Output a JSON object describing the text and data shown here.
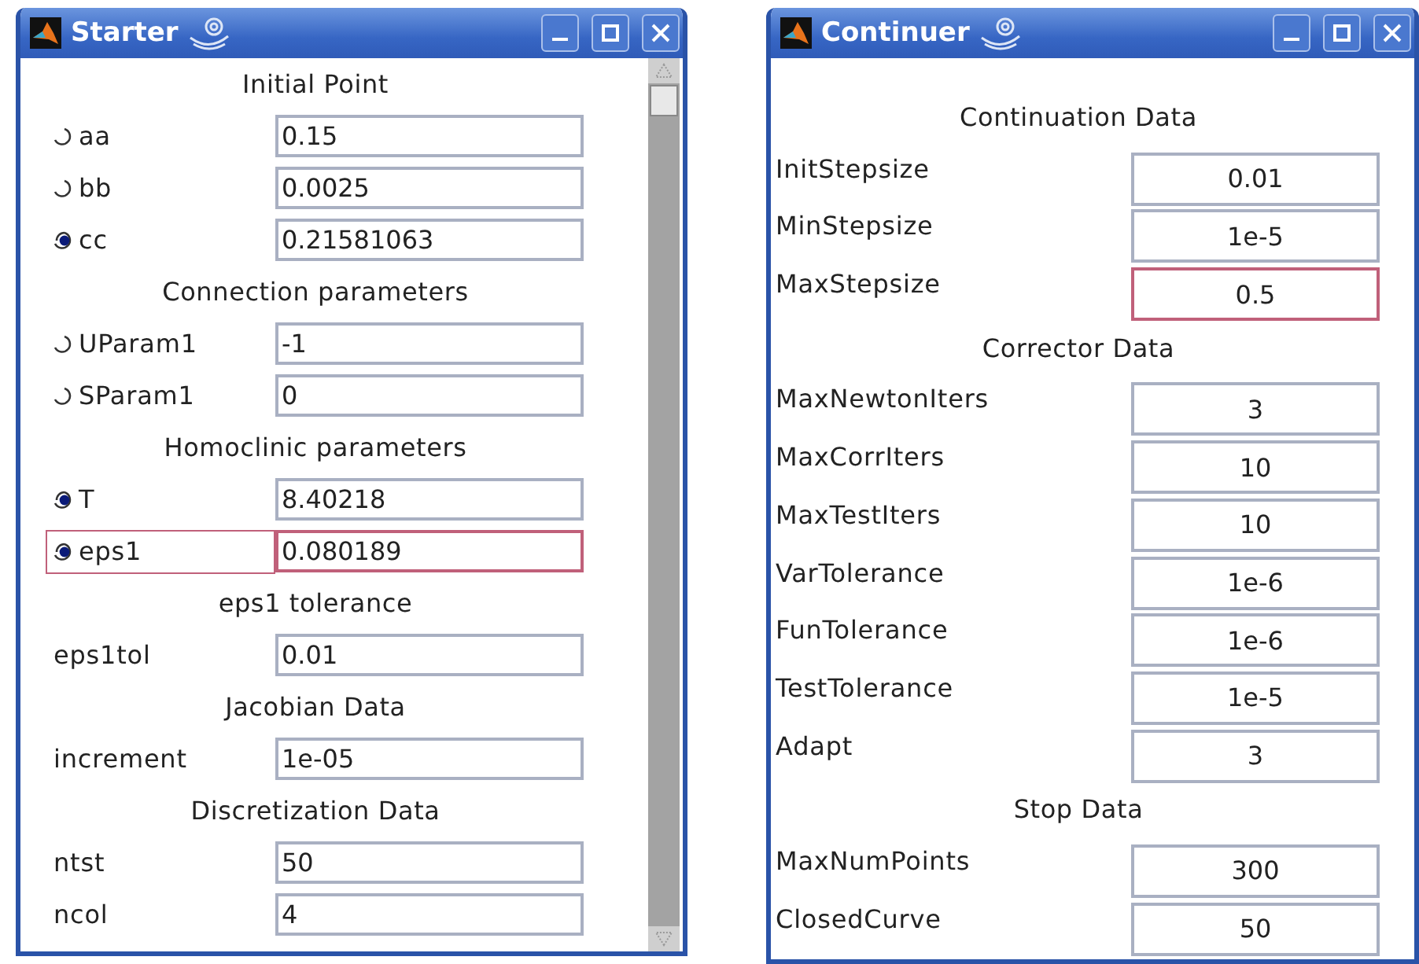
{
  "windows": [
    {
      "title": "Starter",
      "kind": "starter",
      "scrollbar": true,
      "sections": [
        {
          "heading": "Initial Point",
          "rows": [
            {
              "kind": "radio",
              "label": "aa",
              "value": "0.15",
              "selected": false,
              "focused": false
            },
            {
              "kind": "radio",
              "label": "bb",
              "value": "0.0025",
              "selected": false,
              "focused": false
            },
            {
              "kind": "radio",
              "label": "cc",
              "value": "0.21581063",
              "selected": true,
              "focused": false
            }
          ]
        },
        {
          "heading": "Connection parameters",
          "rows": [
            {
              "kind": "radio",
              "label": "UParam1",
              "value": "-1",
              "selected": false,
              "focused": false
            },
            {
              "kind": "radio",
              "label": "SParam1",
              "value": "0",
              "selected": false,
              "focused": false
            }
          ]
        },
        {
          "heading": "Homoclinic parameters",
          "rows": [
            {
              "kind": "radio",
              "label": "T",
              "value": "8.40218",
              "selected": true,
              "focused": false
            },
            {
              "kind": "radio",
              "label": "eps1",
              "value": "0.080189",
              "selected": true,
              "focused": true
            }
          ]
        },
        {
          "heading": "eps1 tolerance",
          "rows": [
            {
              "kind": "plain",
              "label": "eps1tol",
              "value": "0.01",
              "focused": false
            }
          ]
        },
        {
          "heading": "Jacobian Data",
          "rows": [
            {
              "kind": "plain",
              "label": "increment",
              "value": "1e-05",
              "focused": false
            }
          ]
        },
        {
          "heading": "Discretization Data",
          "rows": [
            {
              "kind": "plain",
              "label": "ntst",
              "value": "50",
              "focused": false
            },
            {
              "kind": "plain",
              "label": "ncol",
              "value": "4",
              "focused": false
            }
          ]
        }
      ]
    },
    {
      "title": "Continuer",
      "kind": "continuer",
      "scrollbar": false,
      "sections": [
        {
          "heading": "Continuation Data",
          "rows": [
            {
              "kind": "plain",
              "label": "InitStepsize",
              "value": "0.01",
              "focused": false
            },
            {
              "kind": "plain",
              "label": "MinStepsize",
              "value": "1e-5",
              "focused": false
            },
            {
              "kind": "plain",
              "label": "MaxStepsize",
              "value": "0.5",
              "focused": true
            }
          ]
        },
        {
          "heading": "Corrector Data",
          "rows": [
            {
              "kind": "plain",
              "label": "MaxNewtonIters",
              "value": "3",
              "focused": false
            },
            {
              "kind": "plain",
              "label": "MaxCorrIters",
              "value": "10",
              "focused": false
            },
            {
              "kind": "plain",
              "label": "MaxTestIters",
              "value": "10",
              "focused": false
            },
            {
              "kind": "plain",
              "label": "VarTolerance",
              "value": "1e-6",
              "focused": false
            },
            {
              "kind": "plain",
              "label": "FunTolerance",
              "value": "1e-6",
              "focused": false
            },
            {
              "kind": "plain",
              "label": "TestTolerance",
              "value": "1e-5",
              "focused": false
            },
            {
              "kind": "plain",
              "label": "Adapt",
              "value": "3",
              "focused": false
            }
          ]
        },
        {
          "heading": "Stop Data",
          "rows": [
            {
              "kind": "plain",
              "label": "MaxNumPoints",
              "value": "300",
              "focused": false
            },
            {
              "kind": "plain",
              "label": "ClosedCurve",
              "value": "50",
              "focused": false
            }
          ]
        }
      ]
    }
  ]
}
